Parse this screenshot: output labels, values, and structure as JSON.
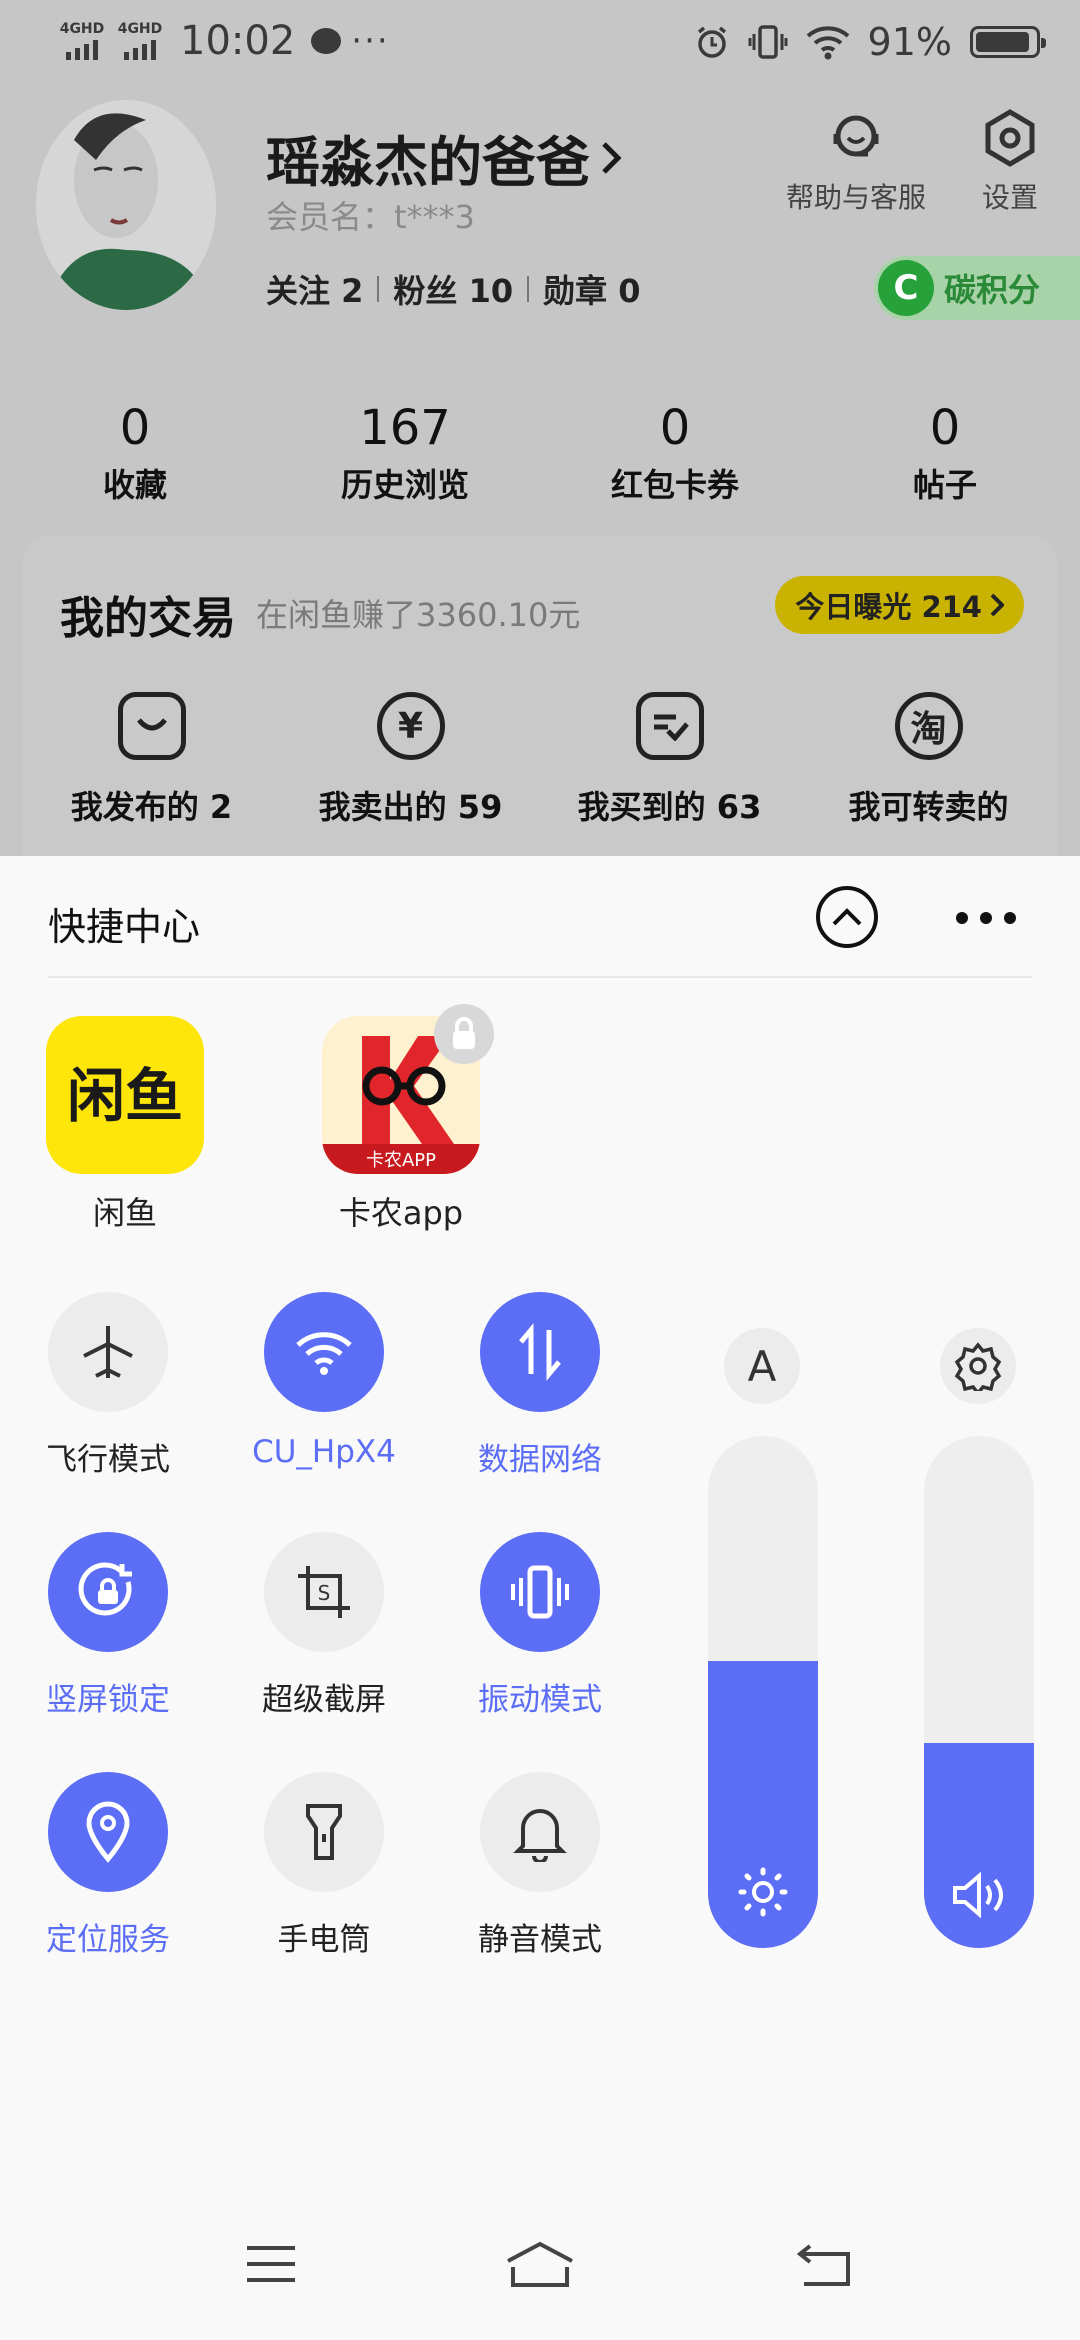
{
  "status_bar": {
    "sim1": "4GHD",
    "sim2": "4GHD",
    "time": "10:02",
    "more": "···",
    "battery_percent": "91%",
    "battery_level": 0.91
  },
  "profile": {
    "name": "瑶淼杰的爸爸",
    "member_label": "会员名：t***3",
    "follow": "关注 2",
    "fans": "粉丝 10",
    "medals": "勋章 0",
    "help_label": "帮助与客服",
    "settings_label": "设置",
    "carbon_letter": "C",
    "carbon_label": "碳积分"
  },
  "stats": [
    {
      "value": "0",
      "label": "收藏"
    },
    {
      "value": "167",
      "label": "历史浏览"
    },
    {
      "value": "0",
      "label": "红包卡券"
    },
    {
      "value": "0",
      "label": "帖子"
    }
  ],
  "trade": {
    "title": "我的交易",
    "subtitle": "在闲鱼赚了3360.10元",
    "exposure": "今日曝光 214",
    "items": [
      {
        "label": "我发布的 2",
        "icon": "bag-icon"
      },
      {
        "label": "我卖出的 59",
        "icon": "yen-icon"
      },
      {
        "label": "我买到的 63",
        "icon": "check-note-icon"
      },
      {
        "label": "我可转卖的",
        "icon": "taobao-icon",
        "glyph": "淘"
      }
    ]
  },
  "quick_center": {
    "title": "快捷中心",
    "apps": [
      {
        "name": "闲鱼",
        "logo_text": "闲鱼",
        "color": "#ffe60a"
      },
      {
        "name": "卡农app",
        "logo_text": "卡农APP",
        "locked": true
      }
    ],
    "tiles": [
      {
        "label": "飞行模式",
        "icon": "airplane-icon",
        "on": false
      },
      {
        "label": "CU_HpX4",
        "icon": "wifi-icon",
        "on": true
      },
      {
        "label": "数据网络",
        "icon": "data-network-icon",
        "on": true
      },
      {
        "label": "竖屏锁定",
        "icon": "rotation-lock-icon",
        "on": true
      },
      {
        "label": "超级截屏",
        "icon": "screenshot-icon",
        "on": false
      },
      {
        "label": "振动模式",
        "icon": "vibrate-icon",
        "on": true
      },
      {
        "label": "定位服务",
        "icon": "location-icon",
        "on": true
      },
      {
        "label": "手电筒",
        "icon": "flashlight-icon",
        "on": false
      },
      {
        "label": "静音模式",
        "icon": "bell-icon",
        "on": false
      }
    ],
    "brightness_level": 0.56,
    "volume_level": 0.4,
    "auto_brightness_letter": "A"
  },
  "colors": {
    "accent": "#5b6ef5",
    "xianyu_yellow": "#ffe60a",
    "carbon_green": "#27a23b"
  }
}
